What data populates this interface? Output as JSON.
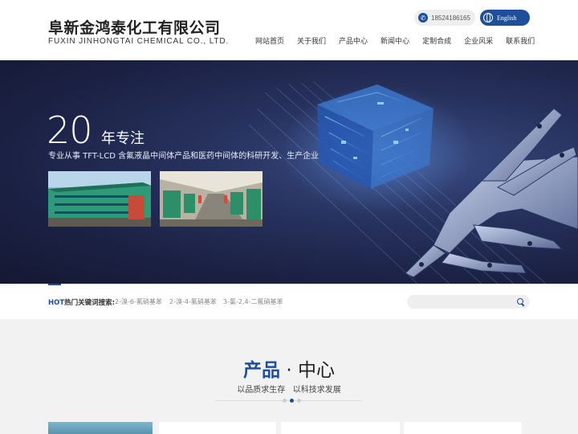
{
  "header": {
    "company_cn": "阜新金鸿泰化工有限公司",
    "company_en": "FUXIN JINHONGTAI CHEMICAL CO., LTD.",
    "phone": "18524186165",
    "language": "English",
    "nav": [
      "网站首页",
      "关于我们",
      "产品中心",
      "新闻中心",
      "定制合成",
      "企业风采",
      "联系我们"
    ]
  },
  "banner": {
    "big_number": "20",
    "headline": "年专注",
    "description": "专业从事 TFT-LCD 含氟液晶中间体产品和医药中间体的科研开发、生产企业"
  },
  "search": {
    "hot_prefix": "HOT",
    "hot_label": "热门关键词搜索:",
    "keywords": [
      "2-溴-6-氟硝基苯",
      "2-溴-4-氟硝基苯",
      "3-氯-2,4-二氟硝基苯"
    ],
    "placeholder": ""
  },
  "products": {
    "title_part1": "产品",
    "title_sep": "·",
    "title_part2": "中心",
    "subtitle": "以品质求生存   以科技求发展"
  },
  "colors": {
    "brand_blue": "#1d4f9a",
    "section_bg": "#f2f2f2"
  },
  "icons": {
    "phone": "phone-icon",
    "language": "globe-icon",
    "search": "search-icon"
  }
}
